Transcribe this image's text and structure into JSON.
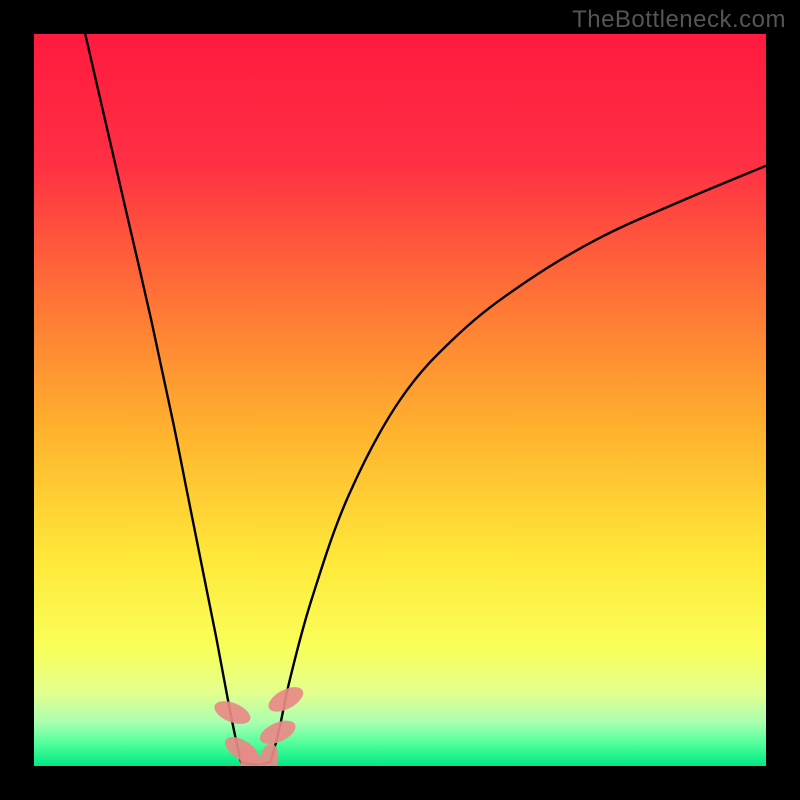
{
  "watermark": "TheBottleneck.com",
  "chart_data": {
    "type": "line",
    "title": "",
    "xlabel": "",
    "ylabel": "",
    "xlim": [
      0,
      100
    ],
    "ylim": [
      0,
      100
    ],
    "grid": false,
    "legend": false,
    "background_gradient": {
      "stops": [
        {
          "pct": 0,
          "color": "#ff1a3f"
        },
        {
          "pct": 18,
          "color": "#ff3044"
        },
        {
          "pct": 38,
          "color": "#ff7a35"
        },
        {
          "pct": 55,
          "color": "#ffb52e"
        },
        {
          "pct": 72,
          "color": "#ffe93a"
        },
        {
          "pct": 84,
          "color": "#f9ff5a"
        },
        {
          "pct": 90,
          "color": "#e3ff8e"
        },
        {
          "pct": 94,
          "color": "#aaffb0"
        },
        {
          "pct": 97,
          "color": "#4fff9b"
        },
        {
          "pct": 100,
          "color": "#00e884"
        }
      ]
    },
    "series": [
      {
        "name": "left_branch",
        "x": [
          7.0,
          10.0,
          13.0,
          16.0,
          19.0,
          21.0,
          23.0,
          25.0,
          26.5,
          27.5,
          28.3
        ],
        "y": [
          100,
          87,
          74,
          61,
          47,
          37,
          27,
          17,
          9,
          4,
          0.5
        ]
      },
      {
        "name": "right_branch",
        "x": [
          32.3,
          33.5,
          35.0,
          38.0,
          43.0,
          50.0,
          58.0,
          67.0,
          77.0,
          88.0,
          100.0
        ],
        "y": [
          0.5,
          5,
          12,
          23,
          37,
          50,
          59,
          66,
          72,
          77,
          82
        ]
      },
      {
        "name": "valley_floor",
        "x": [
          28.3,
          30.3,
          32.3
        ],
        "y": [
          0.5,
          0.2,
          0.5
        ]
      }
    ],
    "markers": [
      {
        "name": "left-marker-upper",
        "x": 27.1,
        "y": 7.3,
        "rx": 1.3,
        "ry": 2.6,
        "angle": -68,
        "color": "#e98a87"
      },
      {
        "name": "left-marker-lower",
        "x": 28.4,
        "y": 2.2,
        "rx": 1.3,
        "ry": 2.6,
        "angle": -58,
        "color": "#e98a87"
      },
      {
        "name": "floor-marker-left",
        "x": 29.5,
        "y": 0.4,
        "rx": 1.3,
        "ry": 2.5,
        "angle": -8,
        "color": "#e98a87"
      },
      {
        "name": "floor-marker-right",
        "x": 32.0,
        "y": 0.6,
        "rx": 1.3,
        "ry": 2.5,
        "angle": 12,
        "color": "#e98a87"
      },
      {
        "name": "right-marker-lower",
        "x": 33.3,
        "y": 4.6,
        "rx": 1.3,
        "ry": 2.6,
        "angle": 66,
        "color": "#e98a87"
      },
      {
        "name": "right-marker-upper",
        "x": 34.4,
        "y": 9.1,
        "rx": 1.3,
        "ry": 2.6,
        "angle": 62,
        "color": "#e98a87"
      }
    ]
  }
}
